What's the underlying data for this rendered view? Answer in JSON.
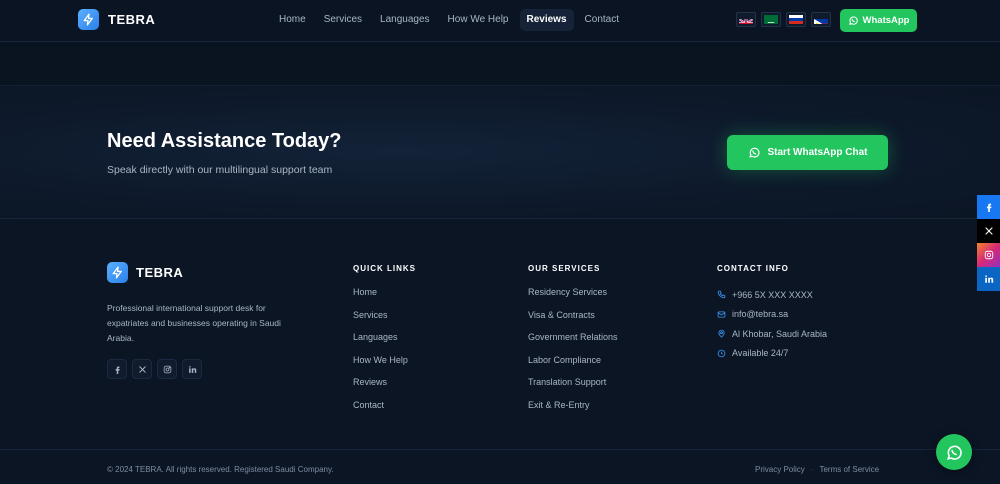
{
  "brand": {
    "name": "TEBRA",
    "icon": "bolt-icon",
    "accent": "#3b95f5"
  },
  "nav": {
    "links": [
      {
        "label": "Home",
        "active": false
      },
      {
        "label": "Services",
        "active": false
      },
      {
        "label": "Languages",
        "active": false
      },
      {
        "label": "How We Help",
        "active": false
      },
      {
        "label": "Reviews",
        "active": true
      },
      {
        "label": "Contact",
        "active": false
      }
    ],
    "languages": [
      "uk-flag",
      "saudi-flag",
      "russia-flag",
      "philippines-flag"
    ],
    "whatsapp_label": "WhatsApp"
  },
  "cta": {
    "title": "Need Assistance Today?",
    "subtitle": "Speak directly with our multilingual support team",
    "button_label": "Start WhatsApp Chat",
    "button_color": "#22c55e"
  },
  "footer": {
    "brand_name": "TEBRA",
    "about": "Professional international support desk for expatriates and businesses operating in Saudi Arabia.",
    "socials": [
      "facebook-icon",
      "x-icon",
      "instagram-icon",
      "linkedin-icon"
    ],
    "quick_links": {
      "title": "QUICK LINKS",
      "items": [
        "Home",
        "Services",
        "Languages",
        "How We Help",
        "Reviews",
        "Contact"
      ]
    },
    "services": {
      "title": "OUR SERVICES",
      "items": [
        "Residency Services",
        "Visa & Contracts",
        "Government Relations",
        "Labor Compliance",
        "Translation Support",
        "Exit & Re-Entry"
      ]
    },
    "contact": {
      "title": "CONTACT INFO",
      "items": [
        {
          "icon": "phone-icon",
          "text": "+966 5X XXX XXXX"
        },
        {
          "icon": "mail-icon",
          "text": "info@tebra.sa"
        },
        {
          "icon": "location-icon",
          "text": "Al Khobar, Saudi Arabia"
        },
        {
          "icon": "clock-icon",
          "text": "Available 24/7"
        }
      ]
    },
    "copyright": "© 2024 TEBRA. All rights reserved. Registered Saudi Company.",
    "legal": {
      "privacy": "Privacy Policy",
      "separator": "·",
      "terms": "Terms of Service"
    }
  },
  "side_rail": {
    "items": [
      {
        "icon": "facebook-icon",
        "color": "#1877f2"
      },
      {
        "icon": "x-icon",
        "color": "#000000"
      },
      {
        "icon": "instagram-icon",
        "color": "#d62976"
      },
      {
        "icon": "linkedin-icon",
        "color": "#0a66c2"
      }
    ]
  }
}
